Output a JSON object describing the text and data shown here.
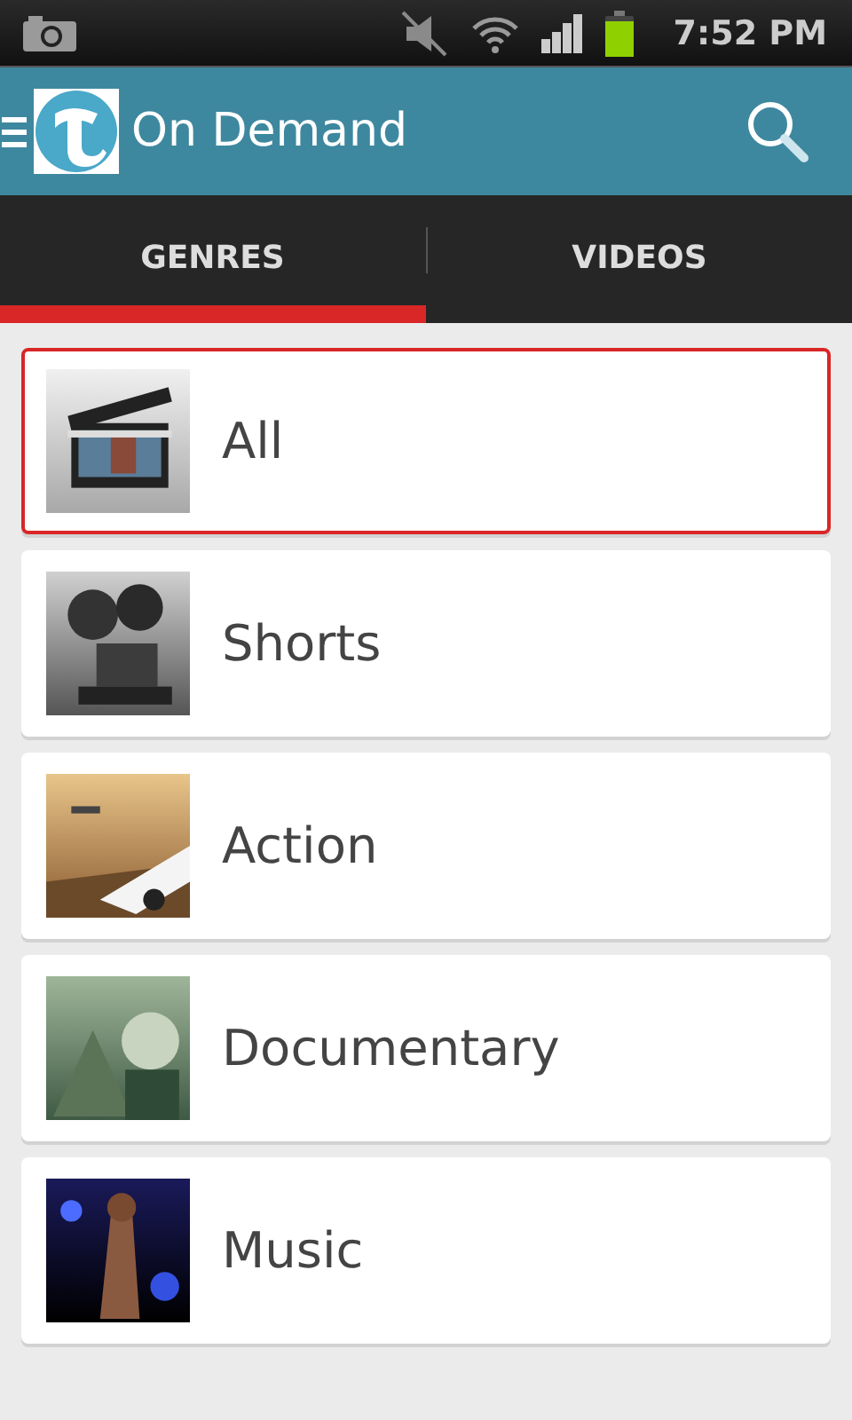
{
  "status_bar": {
    "time": "7:52 PM"
  },
  "app_bar": {
    "title": "On Demand"
  },
  "tabs": [
    {
      "label": "GENRES",
      "selected": true
    },
    {
      "label": "VIDEOS",
      "selected": false
    }
  ],
  "genres": [
    {
      "label": "All",
      "selected": true,
      "kind": "picture"
    },
    {
      "label": "Shorts",
      "selected": false,
      "kind": "picture"
    },
    {
      "label": "Action",
      "selected": false,
      "kind": "picture"
    },
    {
      "label": "Documentary",
      "selected": false,
      "kind": "picture"
    },
    {
      "label": "Music",
      "selected": false,
      "kind": "picture"
    }
  ]
}
